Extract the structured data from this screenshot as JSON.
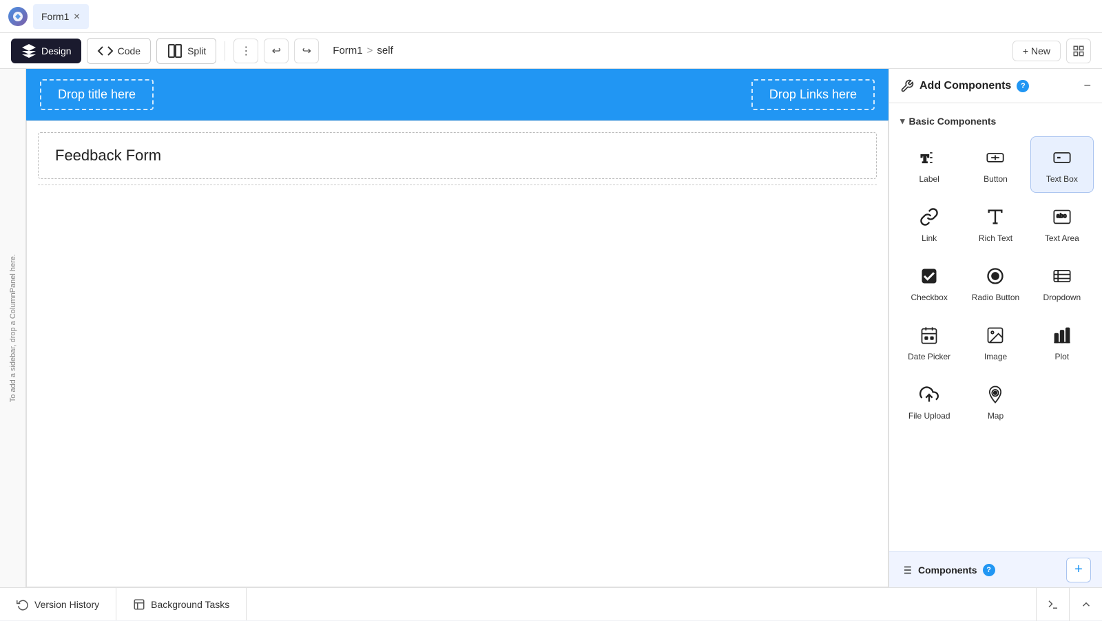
{
  "tabs": [
    {
      "id": "form1",
      "label": "Form1",
      "active": true
    }
  ],
  "toolbar": {
    "design_label": "Design",
    "code_label": "Code",
    "split_label": "Split",
    "breadcrumb_form": "Form1",
    "breadcrumb_sep": ">",
    "breadcrumb_page": "self",
    "new_label": "+ New"
  },
  "canvas": {
    "header": {
      "drop_title": "Drop title here",
      "drop_links": "Drop Links here"
    },
    "form_title": "Feedback Form",
    "sidebar_hint": "To add a sidebar, drop a ColumnPanel here."
  },
  "right_panel": {
    "title": "Add Components",
    "help_label": "?",
    "close_label": "−",
    "basic_section": "Basic Components",
    "components": [
      {
        "id": "label",
        "label": "Label",
        "icon": "label"
      },
      {
        "id": "button",
        "label": "Button",
        "icon": "button"
      },
      {
        "id": "textbox",
        "label": "Text Box",
        "icon": "textbox",
        "highlighted": true
      },
      {
        "id": "link",
        "label": "Link",
        "icon": "link"
      },
      {
        "id": "richtext",
        "label": "Rich Text",
        "icon": "richtext"
      },
      {
        "id": "textarea",
        "label": "Text Area",
        "icon": "textarea"
      },
      {
        "id": "checkbox",
        "label": "Checkbox",
        "icon": "checkbox"
      },
      {
        "id": "radio",
        "label": "Radio Button",
        "icon": "radio"
      },
      {
        "id": "dropdown",
        "label": "Dropdown",
        "icon": "dropdown"
      },
      {
        "id": "datepicker",
        "label": "Date Picker",
        "icon": "datepicker"
      },
      {
        "id": "image",
        "label": "Image",
        "icon": "image"
      },
      {
        "id": "plot",
        "label": "Plot",
        "icon": "plot"
      },
      {
        "id": "upload",
        "label": "File Upload",
        "icon": "upload"
      },
      {
        "id": "map",
        "label": "Map",
        "icon": "map"
      }
    ],
    "components_footer": "Components",
    "components_footer_help": "?"
  },
  "status_bar": {
    "version_history": "Version History",
    "background_tasks": "Background Tasks"
  }
}
